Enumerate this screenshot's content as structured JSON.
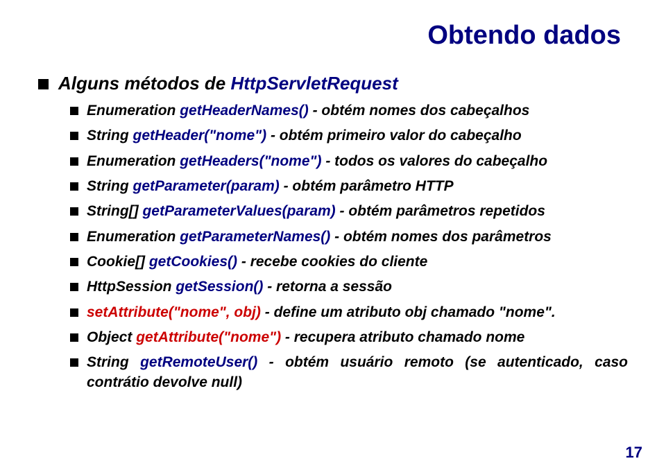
{
  "title": "Obtendo dados",
  "heading": {
    "pre": "Alguns métodos de ",
    "api": "HttpServletRequest"
  },
  "items": [
    {
      "pre": "Enumeration ",
      "api": "getHeaderNames()",
      "post": " - obtém nomes dos cabeçalhos",
      "api_color": "blue"
    },
    {
      "pre": "String ",
      "api": "getHeader(\"nome\")",
      "post": " - obtém primeiro valor do cabeçalho",
      "api_color": "blue"
    },
    {
      "pre": "Enumeration ",
      "api": "getHeaders(\"nome\")",
      "post": " - todos os valores do cabeçalho",
      "api_color": "blue"
    },
    {
      "pre": "String ",
      "api": "getParameter(param)",
      "post": " - obtém parâmetro HTTP",
      "api_color": "blue"
    },
    {
      "pre": "String[] ",
      "api": "getParameterValues(param)",
      "post": " - obtém parâmetros repetidos",
      "api_color": "blue"
    },
    {
      "pre": "Enumeration ",
      "api": "getParameterNames()",
      "post": " - obtém nomes dos parâmetros",
      "api_color": "blue"
    },
    {
      "pre": "Cookie[] ",
      "api": "getCookies()",
      "post": " - recebe cookies do cliente",
      "api_color": "blue"
    },
    {
      "pre": "HttpSession ",
      "api": "getSession()",
      "post": " - retorna a sessão",
      "api_color": "blue"
    },
    {
      "pre": "",
      "api": "setAttribute(\"nome\", obj)",
      "post": " - define um atributo obj chamado \"nome\".",
      "api_color": "red"
    },
    {
      "pre": "Object ",
      "api": "getAttribute(\"nome\")",
      "post": " - recupera atributo chamado nome",
      "api_color": "red"
    },
    {
      "pre": "String ",
      "api": "getRemoteUser()",
      "post": " - obtém usuário remoto (se autenticado, caso contrátio devolve null)",
      "api_color": "blue"
    }
  ],
  "page_number": "17"
}
